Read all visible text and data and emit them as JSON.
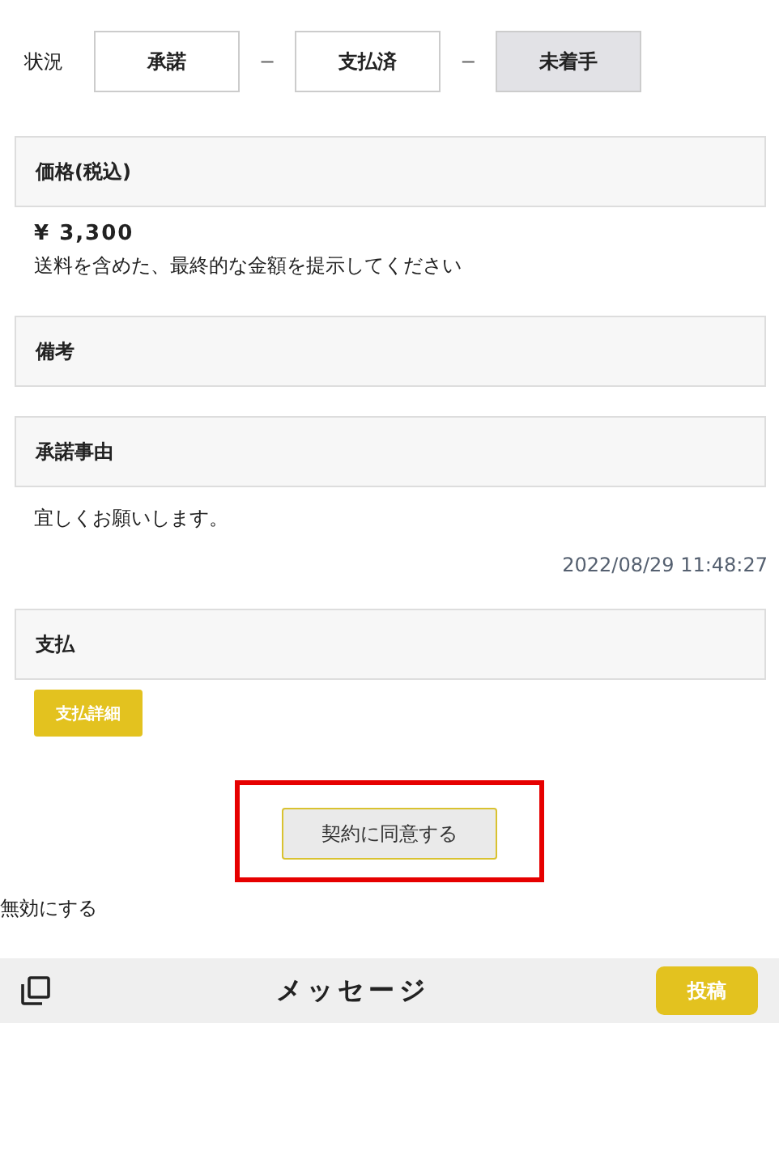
{
  "status": {
    "label": "状況",
    "separator": "−",
    "steps": [
      {
        "label": "承諾",
        "selected": false
      },
      {
        "label": "支払済",
        "selected": false
      },
      {
        "label": "未着手",
        "selected": true
      }
    ]
  },
  "sections": [
    {
      "title": "価格(税込)",
      "amount": "¥ 3,300",
      "note": "送料を含めた、最終的な金額を提示してください"
    },
    {
      "title": "備考"
    },
    {
      "title": "承諾事由",
      "text": "宜しくお願いします。",
      "timestamp": "2022/08/29 11:48:27"
    },
    {
      "title": "支払",
      "button": "支払詳細"
    }
  ],
  "agree_button": {
    "label": "契約に同意する",
    "highlighted": true
  },
  "invalidate_link": "無効にする",
  "message_bar": {
    "title": "メッセージ",
    "post_button": "投稿"
  }
}
